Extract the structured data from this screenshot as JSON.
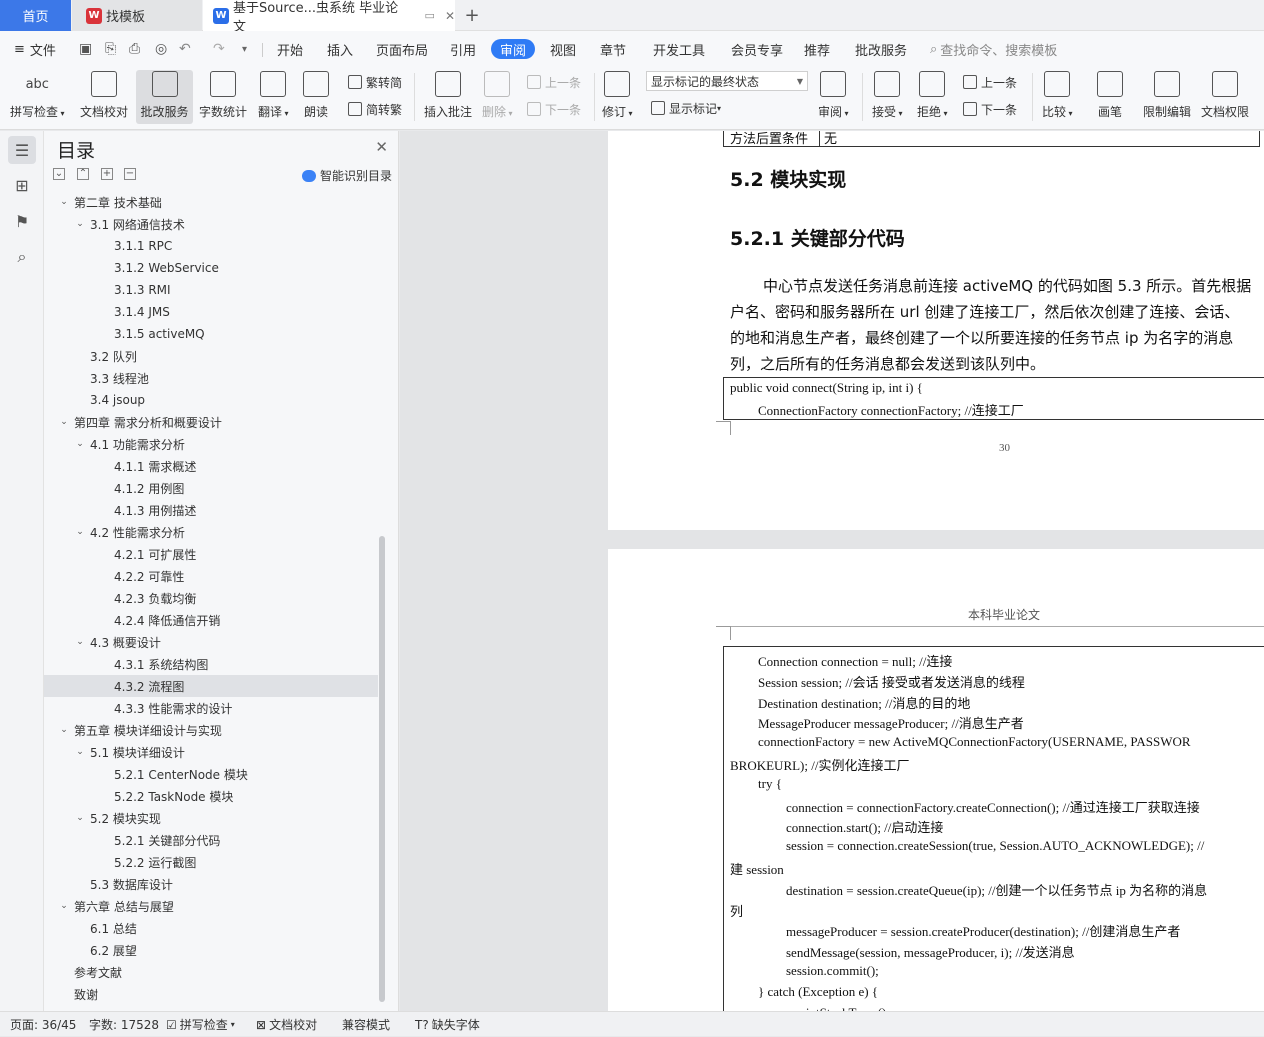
{
  "tabs": {
    "home": "首页",
    "template": "找模板",
    "document": "基于Source...虫系统 毕业论文",
    "new_tab": "+"
  },
  "menu": {
    "file": "文件",
    "items": [
      "开始",
      "插入",
      "页面布局",
      "引用",
      "审阅",
      "视图",
      "章节",
      "开发工具",
      "会员专享",
      "推荐",
      "批改服务"
    ],
    "active": "审阅",
    "search": "查找命令、搜索模板"
  },
  "toolbar": {
    "spell_check": "拼写检查",
    "doc_proof": "文档校对",
    "review_service": "批改服务",
    "word_count": "字数统计",
    "translate": "翻译",
    "read_aloud": "朗读",
    "trad_conv": "繁转简",
    "simp_conv": "简转繁",
    "insert_comment": "插入批注",
    "delete": "删除",
    "prev": "上一条",
    "next": "下一条",
    "revise": "修订",
    "mark_state": "显示标记的最终状态",
    "show_marks": "显示标记",
    "review": "审阅",
    "accept": "接受",
    "reject": "拒绝",
    "prev2": "上一条",
    "next2": "下一条",
    "compare": "比较",
    "pen": "画笔",
    "restrict_edit": "限制编辑",
    "doc_rights": "文档权限",
    "icons": {
      "abc": "abc"
    }
  },
  "toc": {
    "title": "目录",
    "smart": "智能识别目录",
    "items": [
      {
        "label": "第二章  技术基础",
        "level": 0,
        "arrow": "v"
      },
      {
        "label": "3.1  网络通信技术",
        "level": 1,
        "arrow": "v"
      },
      {
        "label": "3.1.1 RPC",
        "level": 2
      },
      {
        "label": "3.1.2 WebService",
        "level": 2
      },
      {
        "label": "3.1.3 RMI",
        "level": 2
      },
      {
        "label": "3.1.4 JMS",
        "level": 2
      },
      {
        "label": "3.1.5 activeMQ",
        "level": 2
      },
      {
        "label": "3.2  队列",
        "level": 1
      },
      {
        "label": "3.3  线程池",
        "level": 1
      },
      {
        "label": "3.4 jsoup",
        "level": 1
      },
      {
        "label": "第四章  需求分析和概要设计",
        "level": 0,
        "arrow": "v"
      },
      {
        "label": "4.1  功能需求分析",
        "level": 1,
        "arrow": "v"
      },
      {
        "label": "4.1.1  需求概述",
        "level": 2
      },
      {
        "label": "4.1.2  用例图",
        "level": 2
      },
      {
        "label": "4.1.3  用例描述",
        "level": 2
      },
      {
        "label": "4.2  性能需求分析",
        "level": 1,
        "arrow": "v"
      },
      {
        "label": "4.2.1  可扩展性",
        "level": 2
      },
      {
        "label": "4.2.2  可靠性",
        "level": 2
      },
      {
        "label": "4.2.3  负载均衡",
        "level": 2
      },
      {
        "label": "4.2.4  降低通信开销",
        "level": 2
      },
      {
        "label": "4.3  概要设计",
        "level": 1,
        "arrow": "v"
      },
      {
        "label": "4.3.1  系统结构图",
        "level": 2
      },
      {
        "label": "4.3.2  流程图",
        "level": 2,
        "selected": true
      },
      {
        "label": "4.3.3  性能需求的设计",
        "level": 2
      },
      {
        "label": "第五章  模块详细设计与实现",
        "level": 0,
        "arrow": "v"
      },
      {
        "label": "5.1  模块详细设计",
        "level": 1,
        "arrow": "v"
      },
      {
        "label": "5.2.1 CenterNode 模块",
        "level": 2
      },
      {
        "label": "5.2.2 TaskNode 模块",
        "level": 2
      },
      {
        "label": "5.2  模块实现",
        "level": 1,
        "arrow": "v"
      },
      {
        "label": "5.2.1  关键部分代码",
        "level": 2
      },
      {
        "label": "5.2.2  运行截图",
        "level": 2
      },
      {
        "label": "5.3  数据库设计",
        "level": 1
      },
      {
        "label": "第六章  总结与展望",
        "level": 0,
        "arrow": "v"
      },
      {
        "label": "6.1  总结",
        "level": 1
      },
      {
        "label": "6.2  展望",
        "level": 1
      },
      {
        "label": "参考文献",
        "level": 0
      },
      {
        "label": "致谢",
        "level": 0
      }
    ]
  },
  "doc": {
    "table_tail_a": "方法后置条件",
    "table_tail_b": "无",
    "h2": "5.2  模块实现",
    "h3": "5.2.1  关键部分代码",
    "para": [
      "中心节点发送任务消息前连接 activeMQ 的代码如图 5.3 所示。首先根据",
      "户名、密码和服务器所在 url 创建了连接工厂，然后依次创建了连接、会话、",
      "的地和消息生产者，最终创建了一个以所要连接的任务节点 ip 为名字的消息",
      "列，之后所有的任务消息都会发送到该队列中。"
    ],
    "code1": [
      "public void connect(String ip, int i) {",
      "ConnectionFactory connectionFactory;      //连接工厂"
    ],
    "page_num": "30",
    "header2": "本科毕业论文",
    "code2": [
      {
        "t": "Connection connection = null;      //连接",
        "i": 1
      },
      {
        "t": "Session session;      //会话  接受或者发送消息的线程",
        "i": 1
      },
      {
        "t": "Destination destination;      //消息的目的地",
        "i": 1
      },
      {
        "t": "MessageProducer messageProducer;      //消息生产者",
        "i": 1
      },
      {
        "t": "connectionFactory    =    new    ActiveMQConnectionFactory(USERNAME,    PASSWOR",
        "i": 1
      },
      {
        "t": "BROKEURL);      //实例化连接工厂",
        "i": 0
      },
      {
        "t": "try {",
        "i": 1
      },
      {
        "t": "connection = connectionFactory.createConnection();      //通过连接工厂获取连接",
        "i": 2
      },
      {
        "t": "connection.start();      //启动连接",
        "i": 2
      },
      {
        "t": "session = connection.createSession(true, Session.AUTO_ACKNOWLEDGE);       //",
        "i": 2
      },
      {
        "t": "建 session",
        "i": 0
      },
      {
        "t": "destination = session.createQueue(ip);      //创建一个以任务节点 ip 为名称的消息",
        "i": 2
      },
      {
        "t": "列",
        "i": 0
      },
      {
        "t": "messageProducer = session.createProducer(destination);      //创建消息生产者",
        "i": 2
      },
      {
        "t": "sendMessage(session, messageProducer, i);      //发送消息",
        "i": 2
      },
      {
        "t": "session.commit();",
        "i": 2
      },
      {
        "t": "} catch (Exception e) {",
        "i": 1
      },
      {
        "t": "e.printStackTrace();",
        "i": 2
      }
    ]
  },
  "status": {
    "page": "页面: 36/45",
    "words": "字数: 17528",
    "spell": "拼写检查",
    "proof": "文档校对",
    "compat": "兼容模式",
    "missing_font": "缺失字体"
  }
}
